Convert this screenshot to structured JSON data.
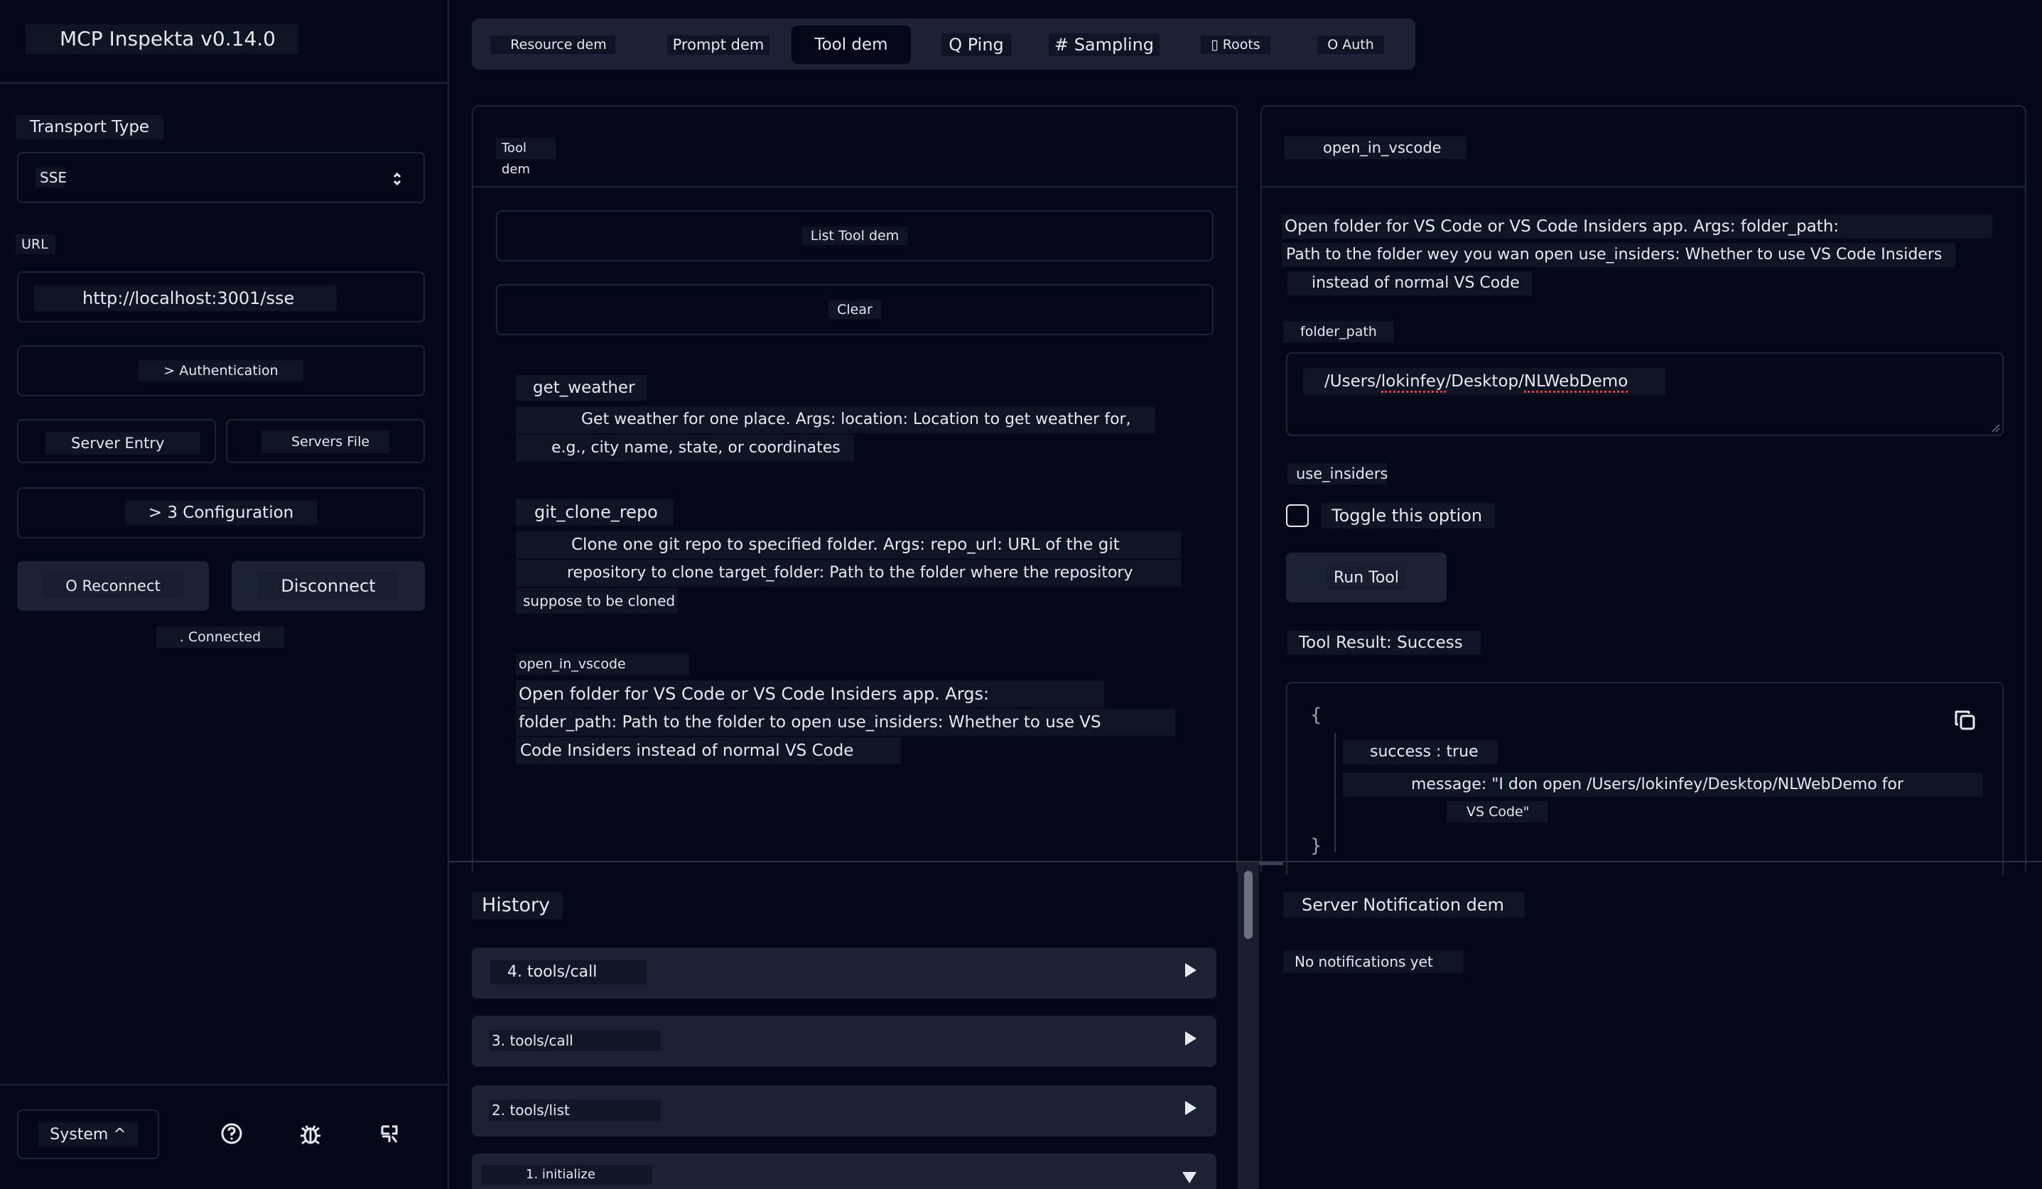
{
  "app": {
    "title": "MCP Inspekta v0.14.0"
  },
  "sidebar": {
    "transport_label": "Transport Type",
    "transport_value": "SSE",
    "url_label": "URL",
    "url_value": "http://localhost:3001/sse",
    "authentication_label": "> Authentication",
    "server_entry_label": "Server Entry",
    "servers_file_label": "Servers File",
    "configuration_label": "> 3 Configuration",
    "reconnect_label": "O Reconnect",
    "disconnect_label": "Disconnect",
    "status_text": ". Connected",
    "theme_label": "System ^"
  },
  "tabs": [
    {
      "label": "Resource dem",
      "active": false
    },
    {
      "label": "Prompt dem",
      "active": false
    },
    {
      "label": "Tool dem",
      "active": true
    },
    {
      "label": "Q Ping",
      "active": false
    },
    {
      "label": "# Sampling",
      "active": false
    },
    {
      "label": "▯ Roots",
      "active": false
    },
    {
      "label": "O Auth",
      "active": false
    }
  ],
  "tools_panel": {
    "title": "Tool dem",
    "list_button": "List Tool dem",
    "clear_button": "Clear",
    "tools": [
      {
        "name": "get_weather",
        "desc_lines": [
          "Get weather for one place. Args: location: Location to get weather for,",
          "e.g., city name, state, or coordinates"
        ]
      },
      {
        "name": "git_clone_repo",
        "desc_lines": [
          "Clone one git repo to specified folder. Args: repo_url: URL of the git",
          "repository to clone target_folder: Path to the folder where the repository",
          "suppose to be cloned"
        ]
      },
      {
        "name": "open_in_vscode",
        "desc_lines": [
          "Open folder for VS Code or VS Code Insiders app. Args:",
          "folder_path: Path to the folder to open use_insiders: Whether to use VS",
          "Code Insiders instead of normal VS Code"
        ]
      }
    ]
  },
  "detail_panel": {
    "title": "open_in_vscode",
    "desc_lines": [
      "Open folder for VS Code or VS Code Insiders app. Args: folder_path:",
      "Path to the folder wey you wan open use_insiders: Whether to use VS Code Insiders",
      "instead of normal VS Code"
    ],
    "folder_path_label": "folder_path",
    "folder_path_value_prefix": "/Users/",
    "folder_path_value_user": "lokinfey",
    "folder_path_value_mid": "/Desktop/",
    "folder_path_value_end": "NLWebDemo",
    "use_insiders_label": "use_insiders",
    "toggle_label": "Toggle this option",
    "run_button": "Run Tool",
    "result_label": "Tool Result: Success",
    "result_open_brace": "{",
    "result_success": "success : true",
    "result_message_line1": "message: \"I don open /Users/lokinfey/Desktop/NLWebDemo for",
    "result_message_line2": "VS Code\"",
    "result_close_brace": "}"
  },
  "history": {
    "title": "History",
    "items": [
      {
        "label": "4. tools/call",
        "expanded": false
      },
      {
        "label": "3. tools/call",
        "expanded": false
      },
      {
        "label": "2. tools/list",
        "expanded": false
      },
      {
        "label": "1. initialize",
        "expanded": true
      }
    ]
  },
  "notifications": {
    "title": "Server Notification dem",
    "empty_text": "No notifications yet"
  },
  "icons": {
    "help": "help-circle-icon",
    "bug": "bug-icon",
    "github": "github-icon",
    "copy": "copy-icon",
    "select": "chevron-updown-icon"
  }
}
